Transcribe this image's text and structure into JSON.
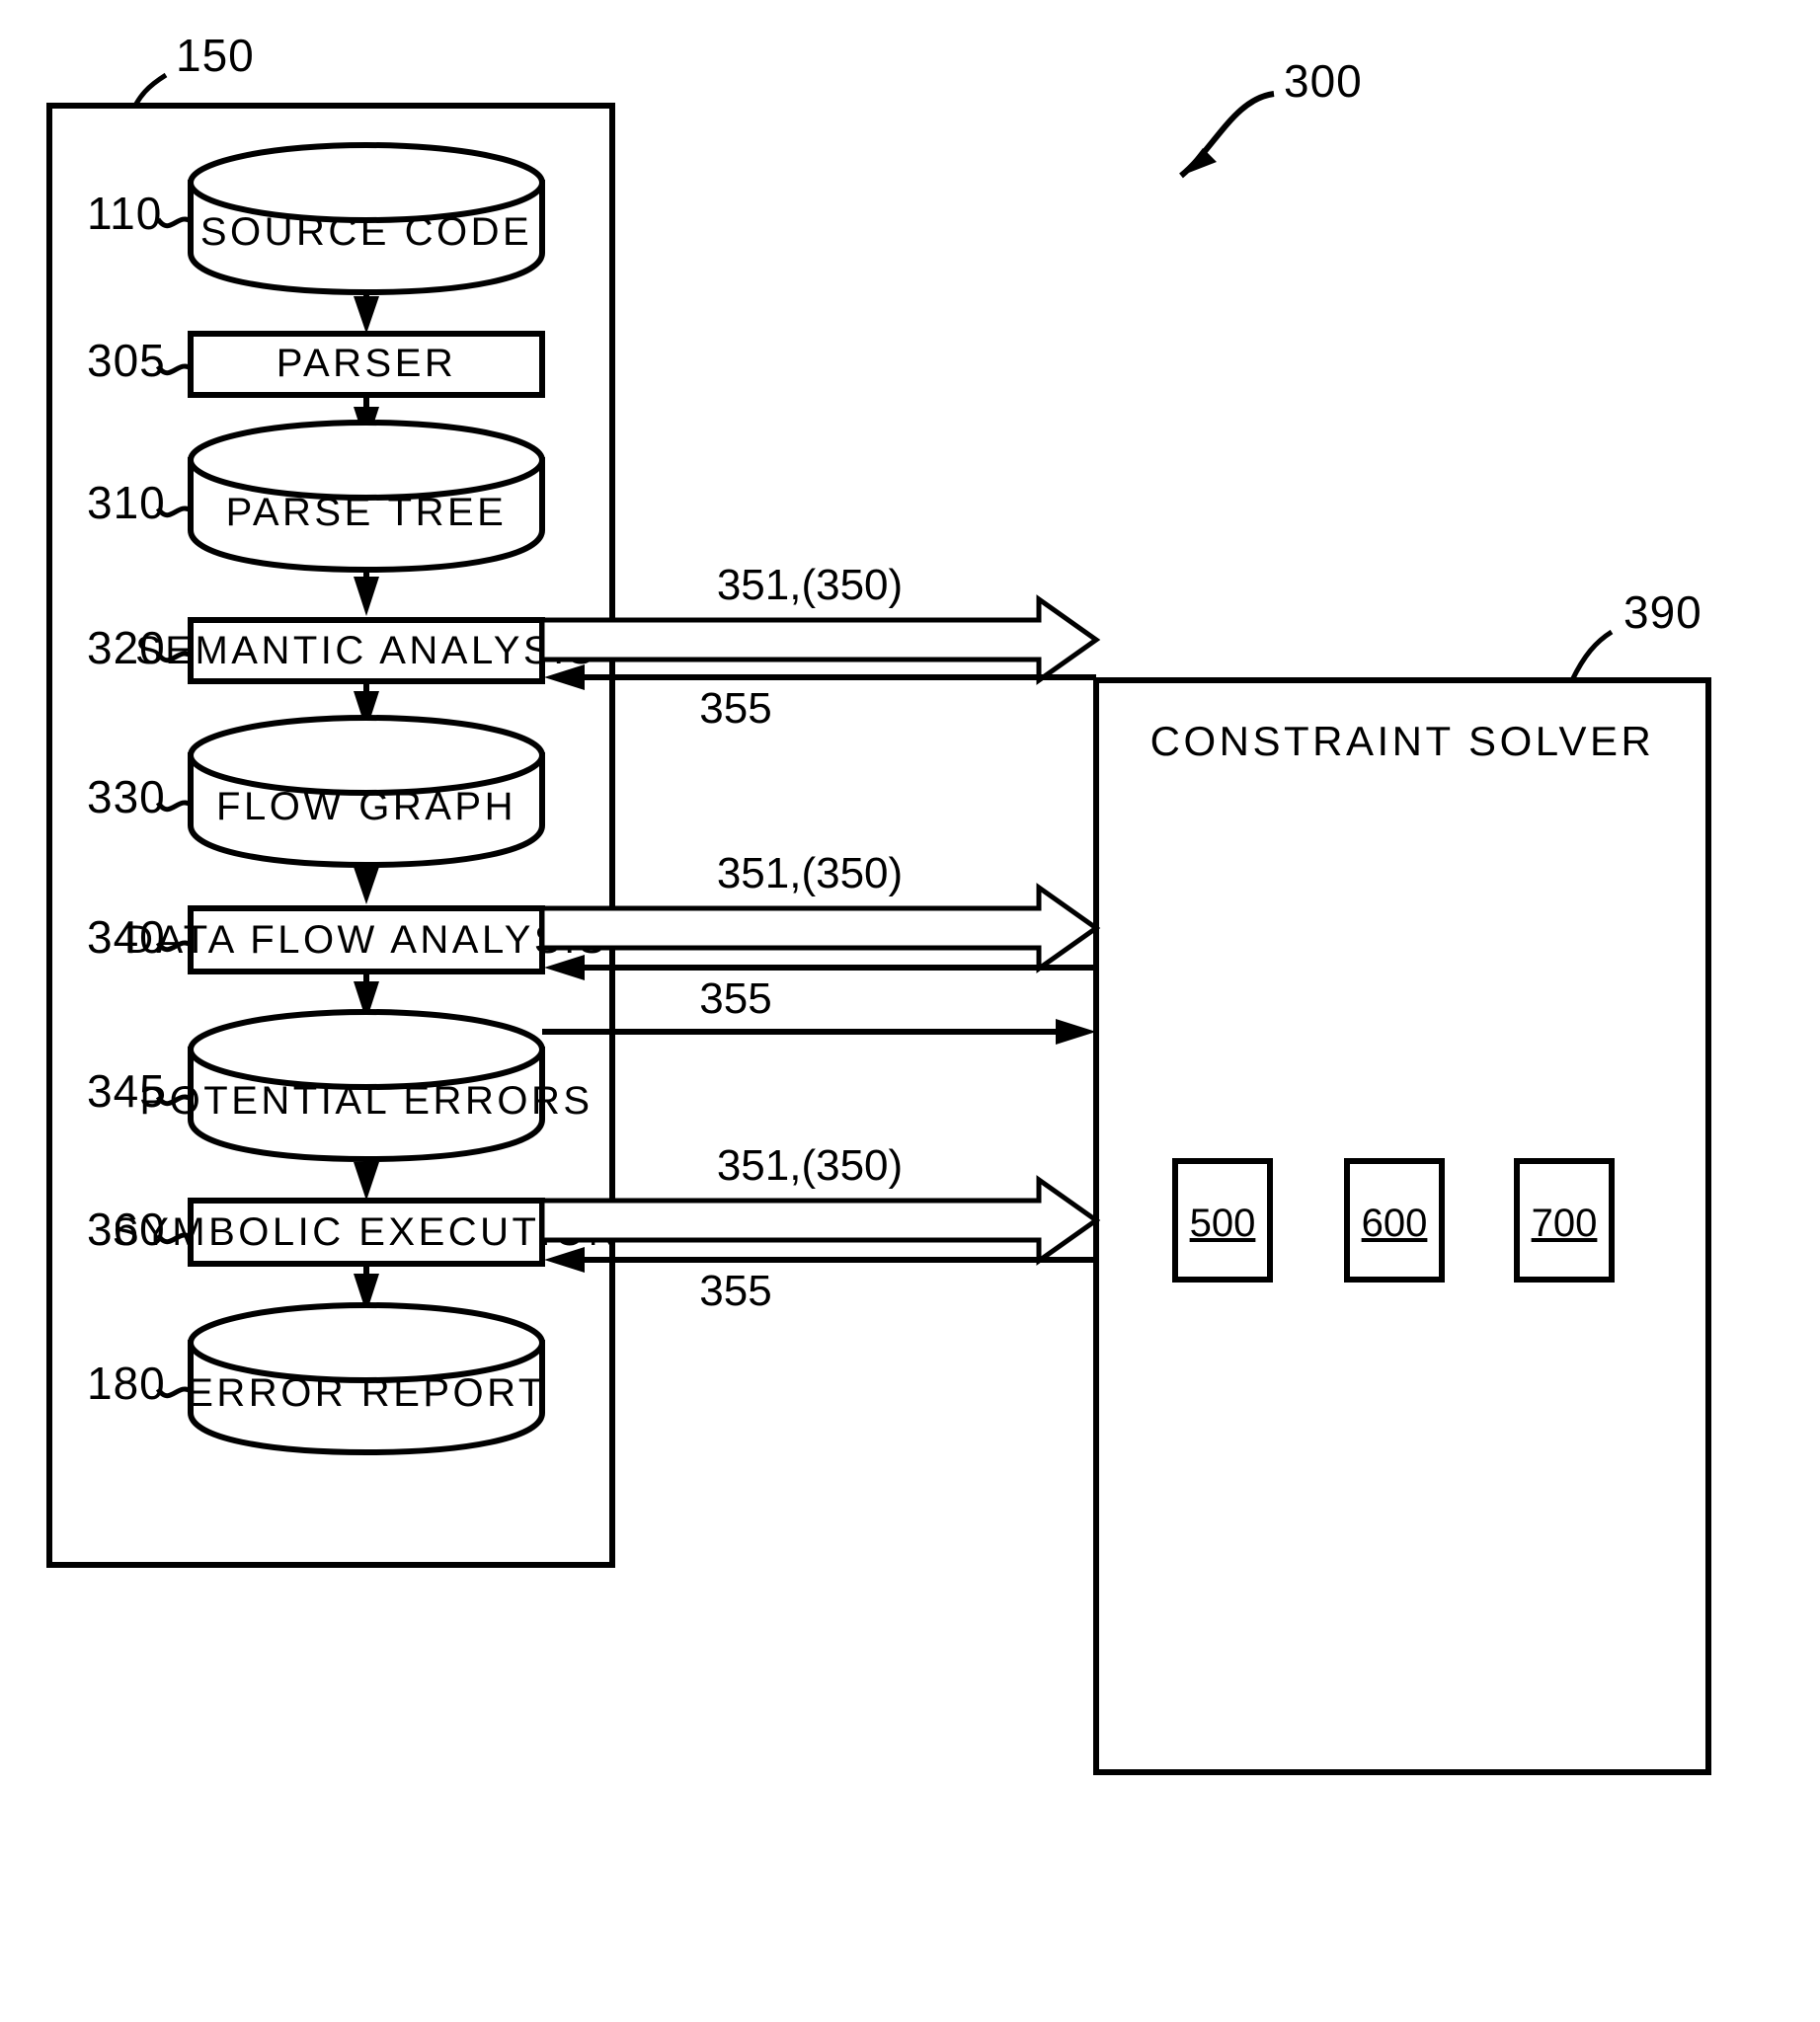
{
  "figure": {
    "type": "patent-flow-diagram",
    "title": "Source code analysis pipeline with constraint solver",
    "callouts": {
      "system_300": "300",
      "container_150": "150",
      "solver_390": "390"
    }
  },
  "pipeline": {
    "container_ref": "150",
    "nodes": [
      {
        "ref": "110",
        "label": "SOURCE CODE",
        "shape": "cylinder"
      },
      {
        "ref": "305",
        "label": "PARSER",
        "shape": "rect"
      },
      {
        "ref": "310",
        "label": "PARSE TREE",
        "shape": "cylinder"
      },
      {
        "ref": "320",
        "label": "SEMANTIC ANALYSIS",
        "shape": "rect"
      },
      {
        "ref": "330",
        "label": "FLOW GRAPH",
        "shape": "cylinder"
      },
      {
        "ref": "340",
        "label": "DATA FLOW ANALYSIS",
        "shape": "rect"
      },
      {
        "ref": "345",
        "label": "POTENTIAL ERRORS",
        "shape": "cylinder"
      },
      {
        "ref": "360",
        "label": "SYMBOLIC EXECUTION",
        "shape": "rect"
      },
      {
        "ref": "180",
        "label": "ERROR REPORT",
        "shape": "cylinder"
      }
    ]
  },
  "solver": {
    "ref": "390",
    "title": "CONSTRAINT SOLVER",
    "chips": [
      {
        "label": "500"
      },
      {
        "label": "600"
      },
      {
        "label": "700"
      }
    ]
  },
  "connections": [
    {
      "from": "320",
      "to": "390",
      "out_label": "351,(350)",
      "in_label": "355"
    },
    {
      "from": "330",
      "to": "390",
      "out_label": "",
      "in_label": ""
    },
    {
      "from": "340",
      "to": "390",
      "out_label": "351,(350)",
      "in_label": "355"
    },
    {
      "from": "360",
      "to": "390",
      "out_label": "351,(350)",
      "in_label": "355"
    }
  ],
  "labels": {
    "out_1": "351,(350)",
    "in_1": "355",
    "out_2": "351,(350)",
    "in_2": "355",
    "out_3": "351,(350)",
    "in_3": "355"
  },
  "colors": {
    "ink": "#000000",
    "paper": "#ffffff"
  }
}
